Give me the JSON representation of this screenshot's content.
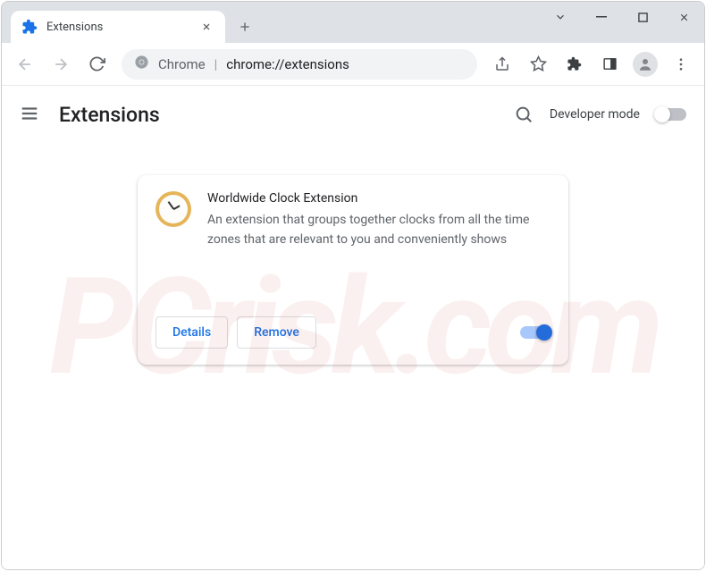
{
  "tab": {
    "title": "Extensions"
  },
  "omnibox": {
    "prefix": "Chrome",
    "separator": "|",
    "url": "chrome://extensions"
  },
  "header": {
    "title": "Extensions",
    "developer_mode_label": "Developer mode",
    "developer_mode_on": false
  },
  "extension": {
    "name": "Worldwide Clock Extension",
    "description": "An extension that groups together clocks from all the time zones that are relevant to you and conveniently shows",
    "details_label": "Details",
    "remove_label": "Remove",
    "enabled": true
  },
  "watermark": "PCrisk.com"
}
